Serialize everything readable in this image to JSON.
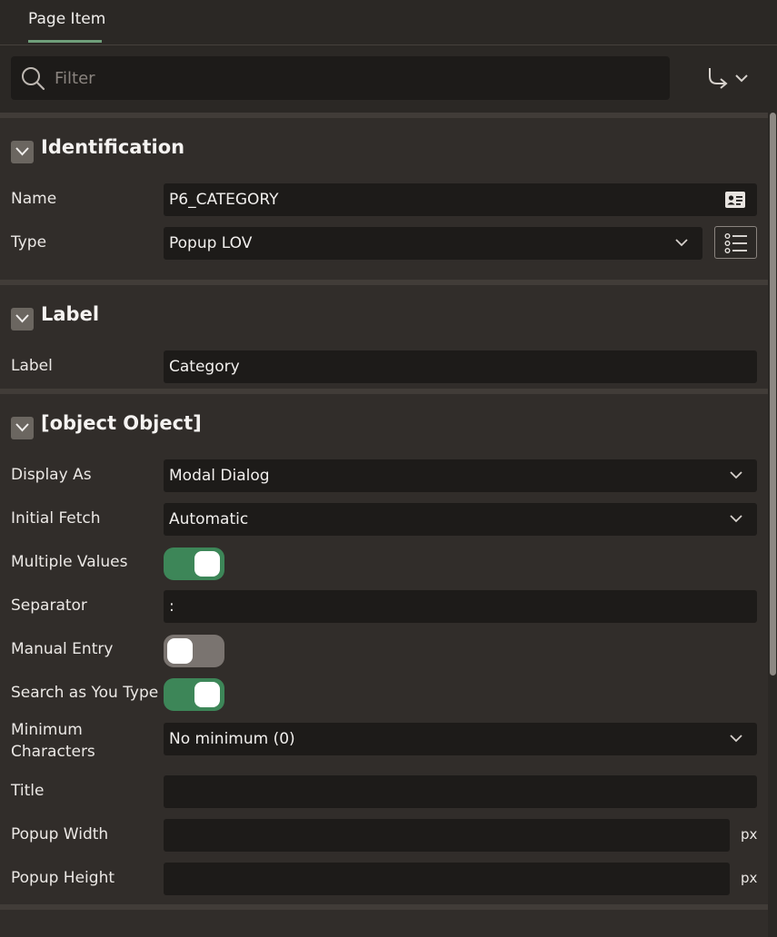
{
  "tabs": [
    {
      "label": "Page Item",
      "active": true
    }
  ],
  "filter": {
    "placeholder": "Filter",
    "value": ""
  },
  "colors": {
    "accent": "#6f9e7a",
    "toggle_on": "#3d8658",
    "toggle_off": "#7a7470",
    "field_bg": "#1d1b19"
  },
  "sections": {
    "identification": {
      "title": "Identification",
      "name": {
        "label": "Name",
        "value": "P6_CATEGORY"
      },
      "type": {
        "label": "Type",
        "value": "Popup LOV"
      }
    },
    "label": {
      "title": "Label",
      "label": {
        "label": "Label",
        "value": "Category"
      }
    },
    "settings": {
      "title": {
        "label": "Title",
        "value": ""
      },
      "display_as": {
        "label": "Display As",
        "value": "Modal Dialog"
      },
      "initial_fetch": {
        "label": "Initial Fetch",
        "value": "Automatic"
      },
      "multiple_values": {
        "label": "Multiple Values",
        "on": true
      },
      "separator": {
        "label": "Separator",
        "value": ":"
      },
      "manual_entry": {
        "label": "Manual Entry",
        "on": false
      },
      "search_as_you_type": {
        "label": "Search as You Type",
        "on": true
      },
      "minimum_characters": {
        "label_line1": "Minimum",
        "label_line2": "Characters",
        "value": "No minimum (0)"
      },
      "popup_width": {
        "label": "Popup Width",
        "value": "",
        "unit": "px"
      },
      "popup_height": {
        "label": "Popup Height",
        "value": "",
        "unit": "px"
      }
    }
  }
}
